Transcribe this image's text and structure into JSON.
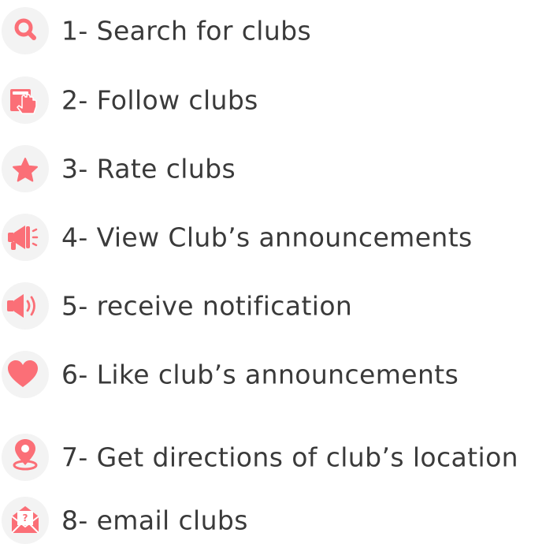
{
  "accent_color": "#fb6f77",
  "features": [
    {
      "icon": "search-icon",
      "label": "1- Search for clubs"
    },
    {
      "icon": "follow-tap-icon",
      "label": "2- Follow clubs"
    },
    {
      "icon": "star-icon",
      "label": "3- Rate clubs"
    },
    {
      "icon": "megaphone-icon",
      "label": "4- View Club’s announcements"
    },
    {
      "icon": "speaker-icon",
      "label": "5- receive notification"
    },
    {
      "icon": "heart-icon",
      "label": "6- Like club’s announcements"
    },
    {
      "icon": "location-pin-icon",
      "label": "7- Get directions of club’s location"
    },
    {
      "icon": "email-icon",
      "label": "8- email clubs"
    }
  ]
}
